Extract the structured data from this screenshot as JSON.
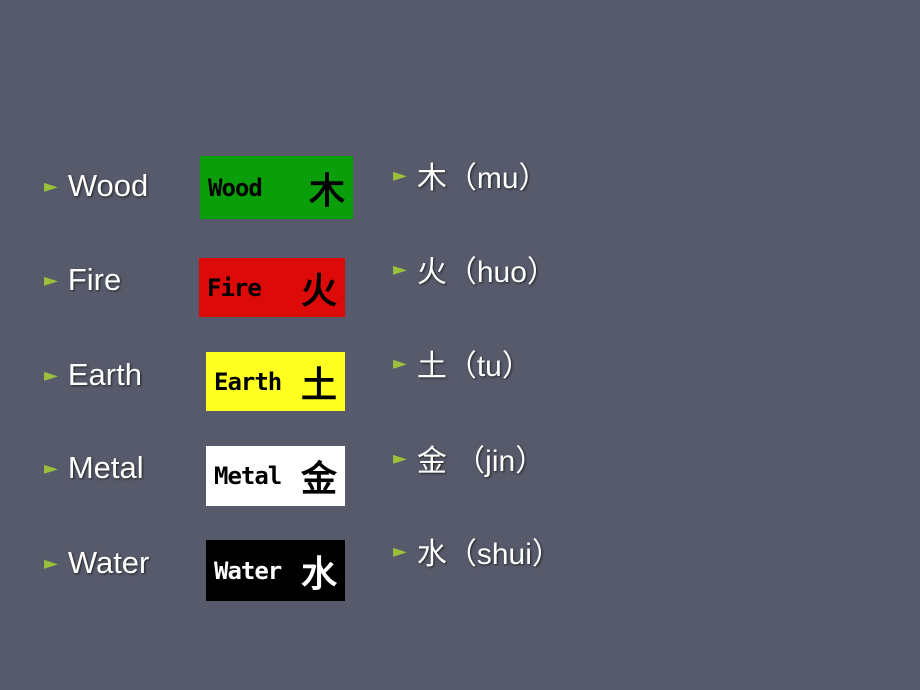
{
  "colors": {
    "background": "#575a6b",
    "bullet": "#9bc03a"
  },
  "elements": [
    {
      "name": "Wood",
      "badge_en": "Wood",
      "badge_zh": "木",
      "badge_bg": "#0a9e0a",
      "badge_fg": "#000000",
      "pinyin": "木（mu）"
    },
    {
      "name": "Fire",
      "badge_en": "Fire",
      "badge_zh": "火",
      "badge_bg": "#dd0a0a",
      "badge_fg": "#000000",
      "pinyin": "火（huo）"
    },
    {
      "name": "Earth",
      "badge_en": "Earth",
      "badge_zh": "土",
      "badge_bg": "#ffff22",
      "badge_fg": "#000000",
      "pinyin": "土（tu）"
    },
    {
      "name": "Metal",
      "badge_en": "Metal",
      "badge_zh": "金",
      "badge_bg": "#ffffff",
      "badge_fg": "#000000",
      "pinyin": "金 （jin）"
    },
    {
      "name": "Water",
      "badge_en": "Water",
      "badge_zh": "水",
      "badge_bg": "#000000",
      "badge_fg": "#ffffff",
      "pinyin": "水（shui）"
    }
  ],
  "bullet_icon": "triangle-right-icon"
}
